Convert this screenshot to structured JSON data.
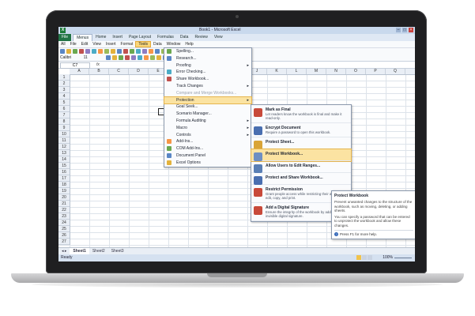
{
  "window": {
    "title": "Book1 - Microsoft Excel"
  },
  "ribbon_tabs": [
    "File",
    "Menus",
    "Home",
    "Insert",
    "Page Layout",
    "Formulas",
    "Data",
    "Review",
    "View"
  ],
  "classic_menus": [
    "All",
    "File",
    "Edit",
    "View",
    "Insert",
    "Format",
    "Tools",
    "Data",
    "Window",
    "Help"
  ],
  "toolbar": {
    "font_name": "Calibri",
    "font_size": "11"
  },
  "name_box": "C7",
  "formula_label": "fx",
  "columns": [
    "A",
    "B",
    "C",
    "D",
    "E",
    "F",
    "G",
    "H",
    "I",
    "J",
    "K",
    "L",
    "M",
    "N",
    "O",
    "P",
    "Q"
  ],
  "rows": [
    "1",
    "2",
    "3",
    "4",
    "5",
    "6",
    "7",
    "8",
    "9",
    "10",
    "11",
    "12",
    "13",
    "14",
    "15",
    "16",
    "17",
    "18",
    "19",
    "20",
    "21",
    "22",
    "23",
    "24",
    "25",
    "26",
    "27"
  ],
  "tools_menu": [
    {
      "label": "Spelling...",
      "icon": "spelling-icon"
    },
    {
      "label": "Research...",
      "icon": "research-icon"
    },
    {
      "label": "Proofing",
      "arrow": "▸"
    },
    {
      "label": "Error Checking...",
      "icon": "error-check-icon"
    },
    {
      "label": "Share Workbook...",
      "icon": "share-icon"
    },
    {
      "label": "Track Changes",
      "arrow": "▸"
    },
    {
      "label": "Compare and Merge Workbooks...",
      "dim": true
    },
    {
      "label": "Protection",
      "arrow": "▸",
      "highlight": true
    },
    {
      "label": "Goal Seek..."
    },
    {
      "label": "Scenario Manager..."
    },
    {
      "label": "Formula Auditing",
      "arrow": "▸"
    },
    {
      "label": "Macro",
      "arrow": "▸"
    },
    {
      "label": "Controls",
      "arrow": "▸"
    },
    {
      "label": "Add-Ins...",
      "icon": "addins-icon"
    },
    {
      "label": "COM Add-Ins...",
      "icon": "com-icon"
    },
    {
      "label": "Document Panel",
      "icon": "doc-panel-icon"
    },
    {
      "label": "Excel Options",
      "icon": "options-icon"
    }
  ],
  "protection_menu": [
    {
      "title": "Mark as Final",
      "desc": "Let readers know the workbook is final and make it read-only.",
      "color": "#c84a3a"
    },
    {
      "title": "Encrypt Document",
      "desc": "Require a password to open this workbook.",
      "color": "#4a6fb0"
    },
    {
      "title": "Protect Sheet...",
      "desc": "",
      "color": "#d9a437"
    },
    {
      "title": "Protect Workbook...",
      "desc": "",
      "color": "#6e8fc2",
      "highlight": true
    },
    {
      "title": "Allow Users to Edit Ranges...",
      "desc": "",
      "color": "#5a7fb5"
    },
    {
      "title": "Protect and Share Workbook...",
      "desc": "",
      "color": "#4a6fb0"
    },
    {
      "title": "Restrict Permission",
      "desc": "Grant people access while restricting their ability to edit, copy, and print.",
      "color": "#c84a3a"
    },
    {
      "title": "Add a Digital Signature",
      "desc": "Ensure the integrity of the workbook by adding an invisible digital signature.",
      "color": "#c84a3a"
    }
  ],
  "tooltip": {
    "title": "Protect Workbook",
    "body1": "Prevent unwanted changes to the structure of the workbook, such as moving, deleting, or adding sheets.",
    "body2": "You can specify a password that can be entered to unprotect the workbook and allow these changes.",
    "help": "Press F1 for more help."
  },
  "sheet_tabs": [
    "Sheet1",
    "Sheet2",
    "Sheet3"
  ],
  "status": {
    "ready": "Ready",
    "zoom": "100%"
  }
}
